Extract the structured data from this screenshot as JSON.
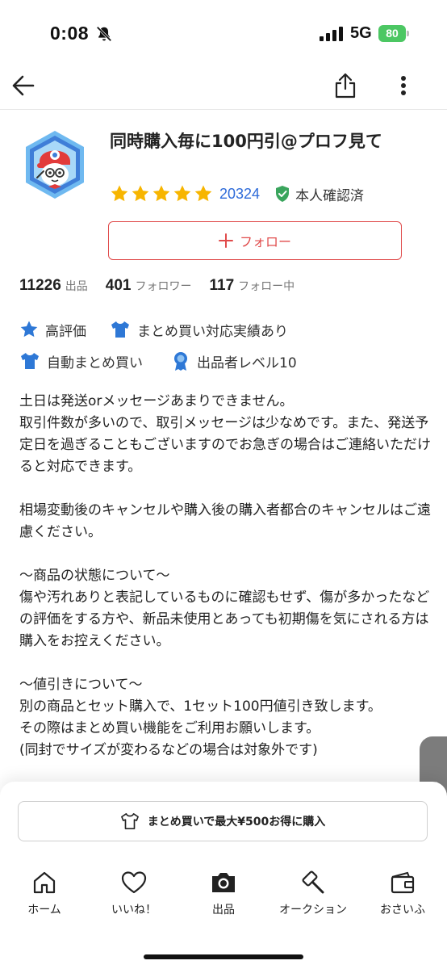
{
  "status_bar": {
    "time": "0:08",
    "network": "5G",
    "battery": "80"
  },
  "profile": {
    "name": "同時購入毎に100円引@プロフ見て",
    "rating_count": "20324",
    "verified_label": "本人確認済",
    "follow_label": "フォロー"
  },
  "stats": [
    {
      "value": "11226",
      "label": "出品"
    },
    {
      "value": "401",
      "label": "フォロワー"
    },
    {
      "value": "117",
      "label": "フォロー中"
    }
  ],
  "badges": [
    {
      "label": "高評価",
      "icon": "star-icon"
    },
    {
      "label": "まとめ買い対応実績あり",
      "icon": "shirt-icon"
    },
    {
      "label": "自動まとめ買い",
      "icon": "shirt-icon"
    },
    {
      "label": "出品者レベル10",
      "icon": "medal-icon"
    }
  ],
  "description": "土日は発送orメッセージあまりできません。\n取引件数が多いので、取引メッセージは少なめです。また、発送予定日を過ぎることもございますのでお急ぎの場合はご連絡いただけると対応できます。\n\n相場変動後のキャンセルや購入後の購入者都合のキャンセルはご遠慮ください。\n\n〜商品の状態について〜\n傷や汚れありと表記しているものに確認もせず、傷が多かったなどの評価をする方や、新品未使用とあっても初期傷を気にされる方は購入をお控えください。\n\n〜値引きについて〜\n別の商品とセット購入で、1セット100円値引き致します。\nその際はまとめ買い機能をご利用お願いします。\n(同封でサイズが変わるなどの場合は対象外です)",
  "bulk_buy": {
    "label": "まとめ買いで最大¥500お得に購入"
  },
  "tabs": [
    {
      "label": "ホーム",
      "icon": "home-icon"
    },
    {
      "label": "いいね！",
      "icon": "heart-icon"
    },
    {
      "label": "出品",
      "icon": "camera-icon"
    },
    {
      "label": "オークション",
      "icon": "gavel-icon"
    },
    {
      "label": "おさいふ",
      "icon": "wallet-icon"
    }
  ],
  "colors": {
    "accent": "#e04b4b",
    "link": "#2e6bd9",
    "star": "#f7b500",
    "verified": "#3aa55d",
    "badge_blue": "#2e78d6"
  }
}
